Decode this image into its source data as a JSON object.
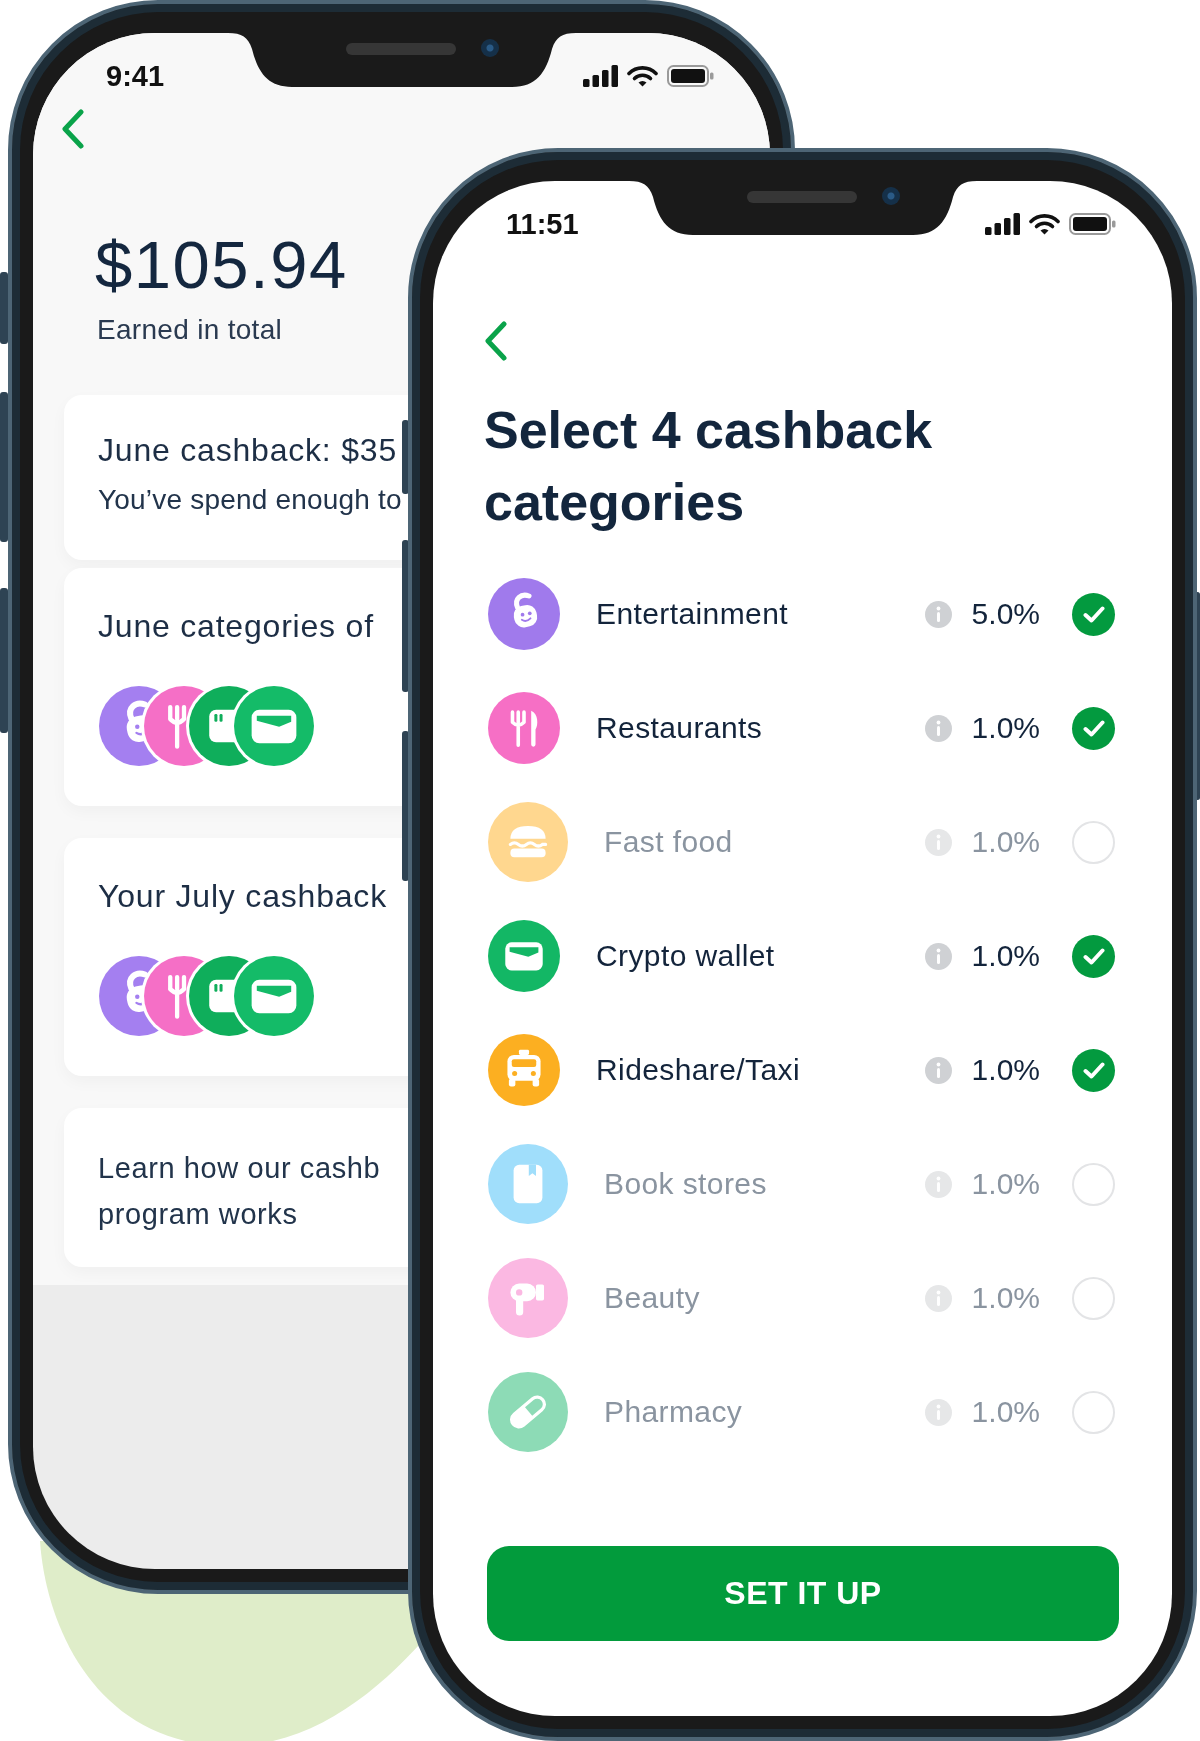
{
  "back_phone": {
    "status_bar": {
      "time": "9:41"
    },
    "balance": {
      "amount": "$105.94",
      "caption": "Earned in total"
    },
    "cards": [
      {
        "kind": "summary",
        "title": "June cashback: $35",
        "text": "You’ve spend enough to"
      },
      {
        "kind": "categories",
        "title": "June categories of",
        "icons": [
          {
            "kind": "entertainment",
            "color": "#a47ff0"
          },
          {
            "kind": "restaurants",
            "color": "#f56fc6"
          },
          {
            "kind": "card",
            "color": "#0fae5b"
          },
          {
            "kind": "crypto_wallet",
            "color": "#14bb68"
          }
        ]
      },
      {
        "kind": "categories",
        "title": "Your July cashback",
        "icons": [
          {
            "kind": "entertainment",
            "color": "#a47ff0"
          },
          {
            "kind": "restaurants",
            "color": "#f56fc6"
          },
          {
            "kind": "card",
            "color": "#0fae5b"
          },
          {
            "kind": "crypto_wallet",
            "color": "#14bb68"
          }
        ]
      },
      {
        "kind": "link",
        "lines": [
          "Learn how our cashb",
          "program works"
        ]
      }
    ]
  },
  "front_phone": {
    "status_bar": {
      "time": "11:51"
    },
    "title": "Select 4 cashback categories",
    "categories": [
      {
        "name": "Entertainment",
        "kind": "entertainment",
        "color": "#a07aec",
        "rate": "5.0%",
        "selected": true
      },
      {
        "name": "Restaurants",
        "kind": "restaurants",
        "color": "#f66fc5",
        "rate": "1.0%",
        "selected": true
      },
      {
        "name": "Fast food",
        "kind": "fast_food",
        "color": "#ffd78f",
        "rate": "1.0%",
        "selected": false
      },
      {
        "name": "Crypto wallet",
        "kind": "crypto_wallet",
        "color": "#13b765",
        "rate": "1.0%",
        "selected": true
      },
      {
        "name": "Rideshare/Taxi",
        "kind": "rideshare",
        "color": "#fcaf21",
        "rate": "1.0%",
        "selected": true
      },
      {
        "name": "Book stores",
        "kind": "books",
        "color": "#a0defb",
        "rate": "1.0%",
        "selected": false
      },
      {
        "name": "Beauty",
        "kind": "beauty",
        "color": "#fbb8e2",
        "rate": "1.0%",
        "selected": false
      },
      {
        "name": "Pharmacy",
        "kind": "pharmacy",
        "color": "#8ddbb6",
        "rate": "1.0%",
        "selected": false
      }
    ],
    "button": "SET IT UP"
  }
}
